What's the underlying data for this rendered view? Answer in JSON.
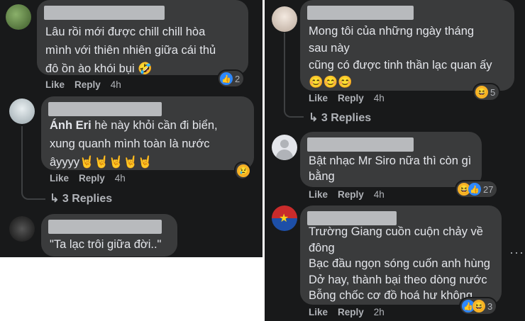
{
  "left": {
    "c1": {
      "text": "Lâu rồi mới được chill chill hòa\nmình với thiên nhiên giữa cái thủ\nđô ồn ào khói bụi 🤣",
      "like": "Like",
      "reply": "Reply",
      "time": "4h",
      "reaction_count": "2"
    },
    "c2": {
      "author": "Ánh Eri",
      "text": " hè này khỏi cần đi biển,\nxung quanh mình toàn là nước\nâyyyy🤘🤘🤘🤘🤘",
      "like": "Like",
      "reply": "Reply",
      "time": "4h",
      "replies": "3 Replies"
    },
    "c3": {
      "text": "\"Ta lạc trôi giữa đời..\""
    }
  },
  "right": {
    "c1": {
      "text": "Mong tôi của những ngày tháng\nsau này\ncũng có được tinh thần lạc quan ấy\n😊😊😊",
      "like": "Like",
      "reply": "Reply",
      "time": "4h",
      "reaction_count": "5",
      "replies": "3 Replies"
    },
    "c2": {
      "text": "Bật nhạc Mr Siro nữa thì còn gì\nbằng",
      "like": "Like",
      "reply": "Reply",
      "time": "4h",
      "reaction_count": "27"
    },
    "c3": {
      "text": "Trường Giang cuồn cuộn chảy về\nđông\nBạc đầu ngọn sóng cuốn anh hùng\nDở hay, thành bại theo dòng nước\nBỗng chốc cơ đồ hoá hư không",
      "like": "Like",
      "reply": "Reply",
      "time": "2h",
      "reaction_count": "3",
      "more": "···"
    }
  },
  "icons": {
    "like": "👍",
    "haha": "😆",
    "sad": "😢",
    "wow": "😮",
    "reply_arrow": "↳"
  },
  "colors": {
    "background": "#18191a",
    "bubble": "#3a3b3c",
    "text": "#e4e6eb",
    "muted": "#b0b3b8",
    "like_blue": "#2d88ff"
  }
}
